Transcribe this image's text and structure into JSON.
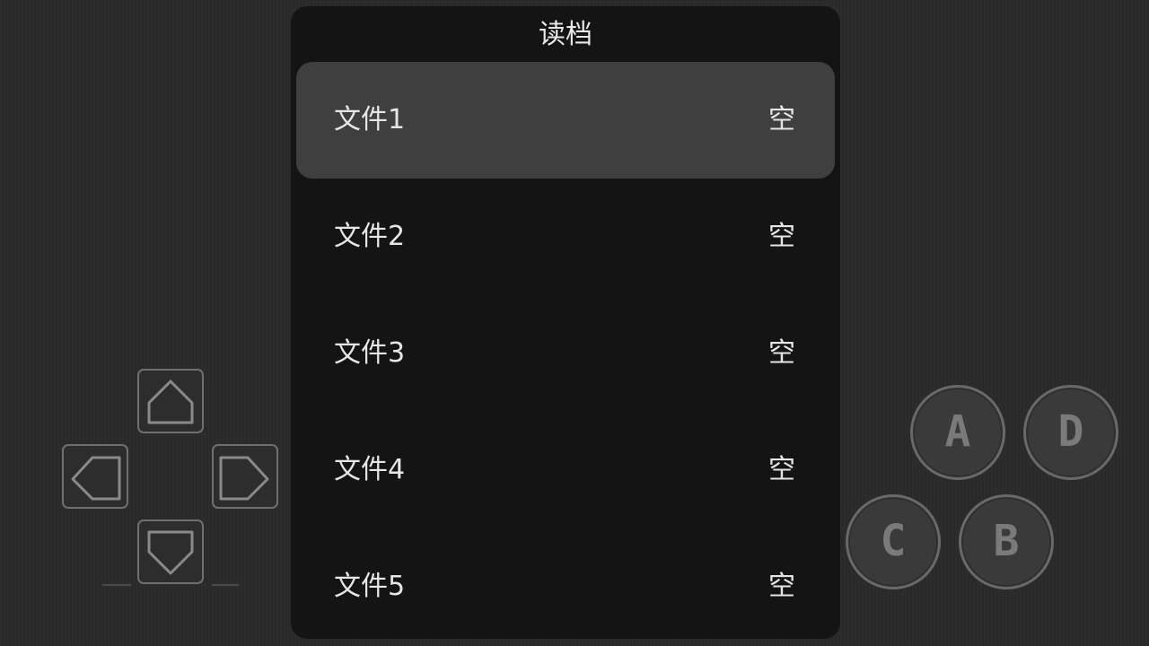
{
  "load_menu": {
    "title": "读档",
    "slots": [
      {
        "name": "文件1",
        "status": "空",
        "selected": true
      },
      {
        "name": "文件2",
        "status": "空",
        "selected": false
      },
      {
        "name": "文件3",
        "status": "空",
        "selected": false
      },
      {
        "name": "文件4",
        "status": "空",
        "selected": false
      },
      {
        "name": "文件5",
        "status": "空",
        "selected": false
      }
    ]
  },
  "dpad": {
    "icons": [
      "up-arrow-icon",
      "left-arrow-icon",
      "right-arrow-icon",
      "down-arrow-icon"
    ]
  },
  "action_buttons": {
    "a": "A",
    "b": "B",
    "c": "C",
    "d": "D"
  },
  "colors": {
    "background": "#2a2a2a",
    "panel": "#141414",
    "selected_slot": "#3f3f3f",
    "text": "#e6e6e6",
    "control_outline": "#6f6f6f"
  }
}
